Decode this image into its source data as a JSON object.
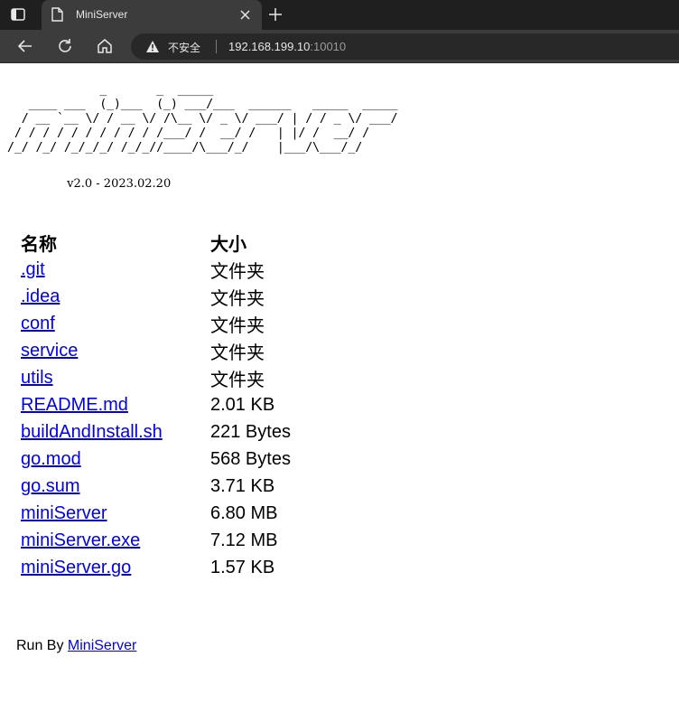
{
  "browser": {
    "tab": {
      "title": "MiniServer"
    },
    "omnibox": {
      "security_label": "不安全",
      "url_host": "192.168.199.10",
      "url_port": ":10010"
    },
    "icons": [
      "sidebar-toggle-icon",
      "page-favicon",
      "close-icon",
      "plus-icon",
      "back-arrow-icon",
      "reload-icon",
      "home-icon",
      "warning-icon"
    ]
  },
  "page": {
    "banner_art": "             _       _  _____\n   ____ ___  (_)___  (_) ___/___  ______   _____  _____\n  / __ `__ \\/ / __ \\/ /\\__ \\/ _ \\/ ___/ | / / _ \\/ ___/\n / / / / / / / / / / /___/ /  __/ /   | |/ /  __/ /\n/_/ /_/ /_/_/_/ /_/_//____/\\___/_/    |___/\\___/_/",
    "version": "                v2.0 - 2023.02.20",
    "table": {
      "headers": {
        "name": "名称",
        "size": "大小"
      },
      "rows": [
        {
          "name": ".git",
          "size": "文件夹"
        },
        {
          "name": ".idea",
          "size": "文件夹"
        },
        {
          "name": "conf",
          "size": "文件夹"
        },
        {
          "name": "service",
          "size": "文件夹"
        },
        {
          "name": "utils",
          "size": "文件夹"
        },
        {
          "name": "README.md",
          "size": "2.01 KB"
        },
        {
          "name": "buildAndInstall.sh",
          "size": "221 Bytes"
        },
        {
          "name": "go.mod",
          "size": "568 Bytes"
        },
        {
          "name": "go.sum",
          "size": "3.71 KB"
        },
        {
          "name": "miniServer",
          "size": "6.80 MB"
        },
        {
          "name": "miniServer.exe",
          "size": "7.12 MB"
        },
        {
          "name": "miniServer.go",
          "size": "1.57 KB"
        }
      ]
    },
    "footer": {
      "prefix": "Run By",
      "link": "MiniServer"
    }
  },
  "colors": {
    "link": "#0000ee",
    "chrome_dark": "#1f1f1f",
    "chrome_tab": "#3c3c3c"
  }
}
